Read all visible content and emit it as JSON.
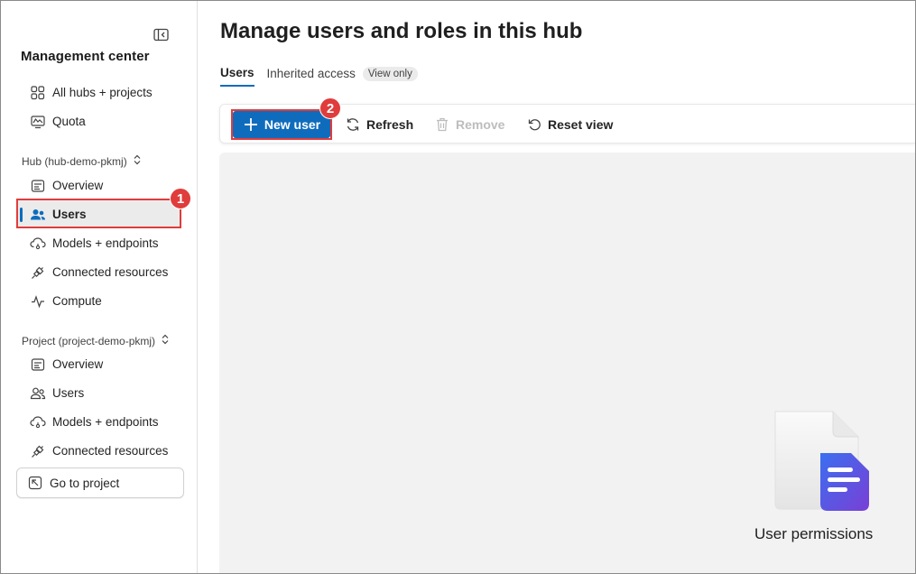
{
  "sidebar": {
    "title": "Management center",
    "top_items": [
      {
        "label": "All hubs + projects",
        "icon": "grid-icon"
      },
      {
        "label": "Quota",
        "icon": "quota-icon"
      }
    ],
    "hub_section": {
      "label": "Hub (hub-demo-pkmj)",
      "items": [
        {
          "label": "Overview",
          "icon": "overview-icon"
        },
        {
          "label": "Users",
          "icon": "people-icon",
          "active": true
        },
        {
          "label": "Models + endpoints",
          "icon": "cloud-icon"
        },
        {
          "label": "Connected resources",
          "icon": "plug-icon"
        },
        {
          "label": "Compute",
          "icon": "pulse-icon"
        }
      ]
    },
    "project_section": {
      "label": "Project (project-demo-pkmj)",
      "items": [
        {
          "label": "Overview",
          "icon": "overview-icon"
        },
        {
          "label": "Users",
          "icon": "people-icon"
        },
        {
          "label": "Models + endpoints",
          "icon": "cloud-icon"
        },
        {
          "label": "Connected resources",
          "icon": "plug-icon"
        }
      ]
    },
    "go_to_project": "Go to project"
  },
  "main": {
    "title": "Manage users and roles in this hub",
    "tabs": [
      {
        "label": "Users",
        "active": true
      },
      {
        "label": "Inherited access",
        "badge": "View only"
      }
    ],
    "toolbar": {
      "new_user": "New user",
      "refresh": "Refresh",
      "remove": "Remove",
      "reset_view": "Reset view"
    },
    "empty_state": {
      "label": "User permissions"
    }
  },
  "annotations": {
    "step1": "1",
    "step2": "2"
  },
  "colors": {
    "accent": "#0f6cbd",
    "highlight": "#e03c3c",
    "illustration_purple": "#7a3fd6",
    "illustration_blue": "#3a6ff0"
  }
}
